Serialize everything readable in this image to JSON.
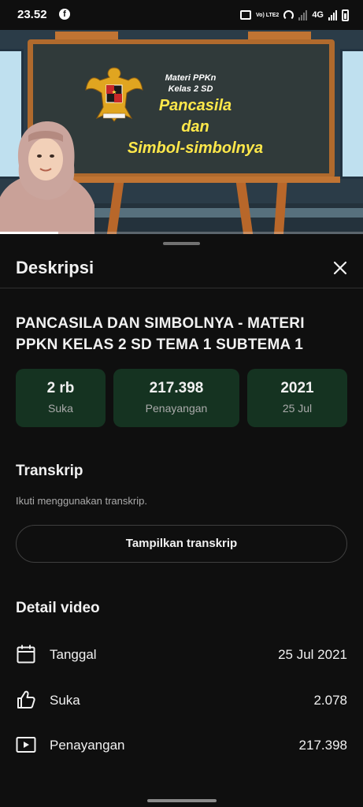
{
  "status_bar": {
    "time": "23.52",
    "volte_label": "Vo) LTE2",
    "network_label": "4G"
  },
  "video": {
    "progress_fraction": 0.16,
    "board": {
      "subtitle_line1": "Materi PPKn",
      "subtitle_line2": "Kelas 2 SD",
      "title_line1": "Pancasila",
      "title_line2": "dan",
      "title_line3": "Simbol-simbolnya"
    }
  },
  "sheet": {
    "title": "Deskripsi",
    "video_title": "PANCASILA DAN SIMBOLNYA - MATERI PPKN KELAS 2 SD TEMA 1 SUBTEMA 1",
    "stats": [
      {
        "value": "2 rb",
        "label": "Suka"
      },
      {
        "value": "217.398",
        "label": "Penayangan"
      },
      {
        "value": "2021",
        "label": "25 Jul"
      }
    ],
    "transcript": {
      "heading": "Transkrip",
      "helper": "Ikuti menggunakan transkrip.",
      "button_label": "Tampilkan transkrip"
    },
    "details": {
      "heading": "Detail video",
      "rows": [
        {
          "icon": "calendar-icon",
          "label": "Tanggal",
          "value": "25 Jul 2021"
        },
        {
          "icon": "thumbs-up-icon",
          "label": "Suka",
          "value": "2.078"
        },
        {
          "icon": "play-box-icon",
          "label": "Penayangan",
          "value": "217.398"
        }
      ]
    }
  },
  "colors": {
    "background": "#0f0f0f",
    "stat_card": "#153321",
    "text_primary": "#f1f1f1",
    "text_secondary": "#aaaaaa",
    "board_text": "#ffe84a"
  }
}
